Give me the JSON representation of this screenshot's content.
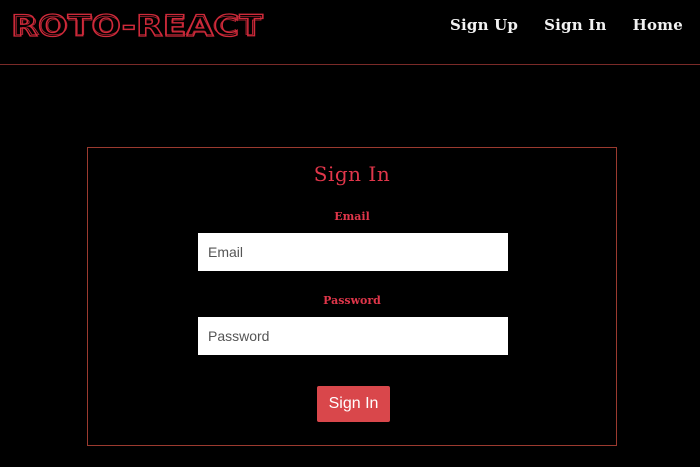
{
  "brand": {
    "logo_text": "ROTO-REACT",
    "color": "#cf2a3a"
  },
  "nav": {
    "links": [
      {
        "label": "Sign Up"
      },
      {
        "label": "Sign In"
      },
      {
        "label": "Home"
      }
    ]
  },
  "form": {
    "title": "Sign In",
    "email": {
      "label": "Email",
      "placeholder": "Email",
      "value": ""
    },
    "password": {
      "label": "Password",
      "placeholder": "Password",
      "value": ""
    },
    "submit_label": "Sign In"
  },
  "colors": {
    "background": "#000000",
    "accent": "#e0364a",
    "button": "#d9474b",
    "border": "#9b3a2f",
    "nav_text": "#f2f2f2"
  }
}
